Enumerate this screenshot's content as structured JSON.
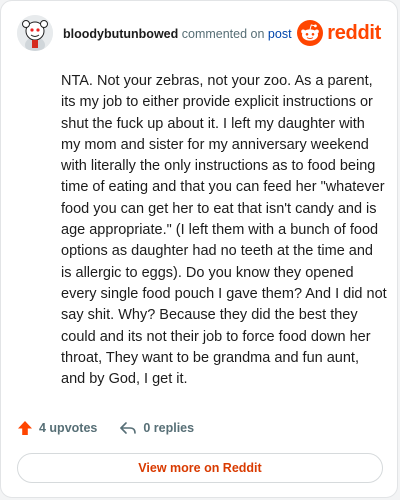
{
  "comment": {
    "username": "bloodybutunbowed",
    "action_text": "commented on",
    "post_link": "post",
    "body": "NTA. Not your zebras, not your zoo. As a parent, its my job to either provide explicit instructions or shut the fuck up about it. I left my daughter with my mom and sister for my anniversary weekend with literally the only instructions as to food being time of eating and that you can feed her \"whatever food you can get her to eat that isn't candy and is age appropriate.\" (I left them with a bunch of food options as daughter had no teeth at the time and is allergic to eggs). Do you know they opened every single food pouch I gave them? And I did not say shit. Why? Because they did the best they could and its not their job to force food down her throat, They want to be grandma and fun aunt, and by God, I get it."
  },
  "brand": {
    "wordmark": "reddit",
    "icon": "reddit-snoo-icon",
    "color": "#ff4500"
  },
  "actions": {
    "upvotes": "4 upvotes",
    "replies": "0 replies",
    "upvote_icon": "upvote-arrow-icon",
    "reply_icon": "reply-arrow-icon",
    "upvote_color": "#ff4500"
  },
  "cta": {
    "label": "View more on Reddit",
    "color": "#d93a00"
  }
}
